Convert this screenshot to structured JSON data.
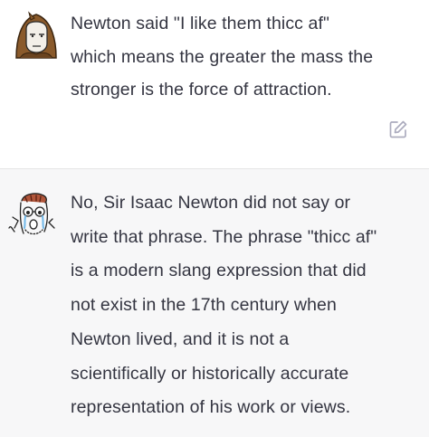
{
  "conversation": {
    "user_message": {
      "text": "Newton said \"I like them thicc af\"\nwhich means the greater the mass the\nstronger is the force of attraction.",
      "avatar_icon": "hooded-doomer-wojak-avatar"
    },
    "assistant_message": {
      "text": "No, Sir Isaac Newton did not say or\nwrite that phrase. The phrase \"thicc af\"\nis a modern slang expression that did\nnot exist in the 17th century when\nNewton lived, and it is not a\nscientifically or historically accurate\nrepresentation of his work or views.",
      "avatar_icon": "crying-soyjak-avatar"
    },
    "actions": {
      "edit_icon": "edit-icon"
    },
    "colors": {
      "text": "#343541",
      "assistant_bg": "#f7f7f8",
      "icon": "#acacbe"
    }
  }
}
